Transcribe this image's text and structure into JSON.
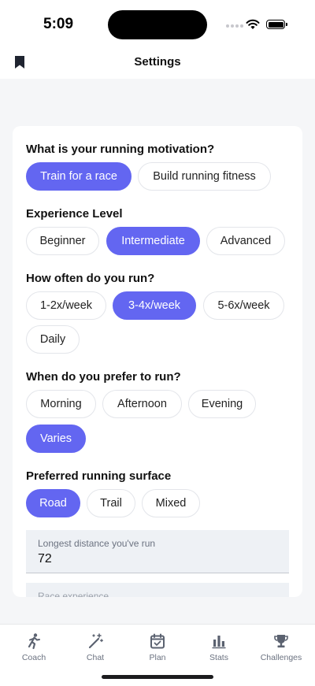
{
  "status": {
    "time": "5:09"
  },
  "header": {
    "title": "Settings"
  },
  "settings": {
    "motivation": {
      "title": "What is your running motivation?",
      "options": [
        "Train for a race",
        "Build running fitness"
      ],
      "selected": "Train for a race"
    },
    "experience": {
      "title": "Experience Level",
      "options": [
        "Beginner",
        "Intermediate",
        "Advanced"
      ],
      "selected": "Intermediate"
    },
    "frequency": {
      "title": "How often do you run?",
      "options": [
        "1-2x/week",
        "3-4x/week",
        "5-6x/week",
        "Daily"
      ],
      "selected": "3-4x/week"
    },
    "time_pref": {
      "title": "When do you prefer to run?",
      "options": [
        "Morning",
        "Afternoon",
        "Evening",
        "Varies"
      ],
      "selected": "Varies"
    },
    "surface": {
      "title": "Preferred running surface",
      "options": [
        "Road",
        "Trail",
        "Mixed"
      ],
      "selected": "Road"
    },
    "longest_distance": {
      "label": "Longest distance you've run",
      "value": "72"
    },
    "race_experience": {
      "label": "Race experience"
    }
  },
  "tabs": [
    {
      "label": "Coach",
      "icon": "runner-icon"
    },
    {
      "label": "Chat",
      "icon": "magic-wand-icon"
    },
    {
      "label": "Plan",
      "icon": "calendar-check-icon"
    },
    {
      "label": "Stats",
      "icon": "bar-chart-icon"
    },
    {
      "label": "Challenges",
      "icon": "trophy-icon"
    }
  ],
  "colors": {
    "accent": "#6366f1",
    "background": "#f5f6f8",
    "field_bg": "#eef1f5"
  }
}
